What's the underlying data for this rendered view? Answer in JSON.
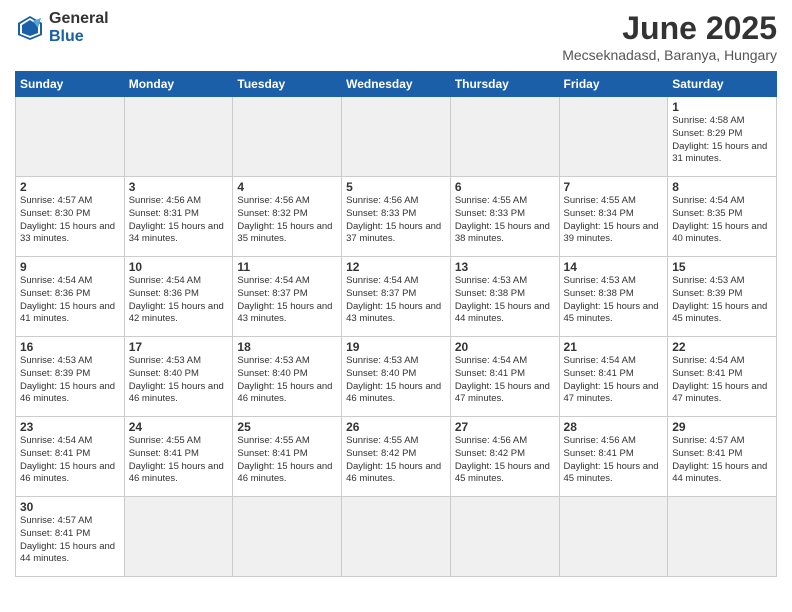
{
  "logo": {
    "general": "General",
    "blue": "Blue"
  },
  "title": "June 2025",
  "subtitle": "Mecseknadasd, Baranya, Hungary",
  "headers": [
    "Sunday",
    "Monday",
    "Tuesday",
    "Wednesday",
    "Thursday",
    "Friday",
    "Saturday"
  ],
  "days": [
    {
      "num": "",
      "sunrise": "",
      "sunset": "",
      "daylight": "",
      "empty": true
    },
    {
      "num": "",
      "sunrise": "",
      "sunset": "",
      "daylight": "",
      "empty": true
    },
    {
      "num": "",
      "sunrise": "",
      "sunset": "",
      "daylight": "",
      "empty": true
    },
    {
      "num": "",
      "sunrise": "",
      "sunset": "",
      "daylight": "",
      "empty": true
    },
    {
      "num": "",
      "sunrise": "",
      "sunset": "",
      "daylight": "",
      "empty": true
    },
    {
      "num": "",
      "sunrise": "",
      "sunset": "",
      "daylight": "",
      "empty": true
    },
    {
      "num": "1",
      "sunrise": "Sunrise: 4:58 AM",
      "sunset": "Sunset: 8:29 PM",
      "daylight": "Daylight: 15 hours and 31 minutes."
    },
    {
      "num": "2",
      "sunrise": "Sunrise: 4:57 AM",
      "sunset": "Sunset: 8:30 PM",
      "daylight": "Daylight: 15 hours and 33 minutes."
    },
    {
      "num": "3",
      "sunrise": "Sunrise: 4:56 AM",
      "sunset": "Sunset: 8:31 PM",
      "daylight": "Daylight: 15 hours and 34 minutes."
    },
    {
      "num": "4",
      "sunrise": "Sunrise: 4:56 AM",
      "sunset": "Sunset: 8:32 PM",
      "daylight": "Daylight: 15 hours and 35 minutes."
    },
    {
      "num": "5",
      "sunrise": "Sunrise: 4:56 AM",
      "sunset": "Sunset: 8:33 PM",
      "daylight": "Daylight: 15 hours and 37 minutes."
    },
    {
      "num": "6",
      "sunrise": "Sunrise: 4:55 AM",
      "sunset": "Sunset: 8:33 PM",
      "daylight": "Daylight: 15 hours and 38 minutes."
    },
    {
      "num": "7",
      "sunrise": "Sunrise: 4:55 AM",
      "sunset": "Sunset: 8:34 PM",
      "daylight": "Daylight: 15 hours and 39 minutes."
    },
    {
      "num": "8",
      "sunrise": "Sunrise: 4:54 AM",
      "sunset": "Sunset: 8:35 PM",
      "daylight": "Daylight: 15 hours and 40 minutes."
    },
    {
      "num": "9",
      "sunrise": "Sunrise: 4:54 AM",
      "sunset": "Sunset: 8:36 PM",
      "daylight": "Daylight: 15 hours and 41 minutes."
    },
    {
      "num": "10",
      "sunrise": "Sunrise: 4:54 AM",
      "sunset": "Sunset: 8:36 PM",
      "daylight": "Daylight: 15 hours and 42 minutes."
    },
    {
      "num": "11",
      "sunrise": "Sunrise: 4:54 AM",
      "sunset": "Sunset: 8:37 PM",
      "daylight": "Daylight: 15 hours and 43 minutes."
    },
    {
      "num": "12",
      "sunrise": "Sunrise: 4:54 AM",
      "sunset": "Sunset: 8:37 PM",
      "daylight": "Daylight: 15 hours and 43 minutes."
    },
    {
      "num": "13",
      "sunrise": "Sunrise: 4:53 AM",
      "sunset": "Sunset: 8:38 PM",
      "daylight": "Daylight: 15 hours and 44 minutes."
    },
    {
      "num": "14",
      "sunrise": "Sunrise: 4:53 AM",
      "sunset": "Sunset: 8:38 PM",
      "daylight": "Daylight: 15 hours and 45 minutes."
    },
    {
      "num": "15",
      "sunrise": "Sunrise: 4:53 AM",
      "sunset": "Sunset: 8:39 PM",
      "daylight": "Daylight: 15 hours and 45 minutes."
    },
    {
      "num": "16",
      "sunrise": "Sunrise: 4:53 AM",
      "sunset": "Sunset: 8:39 PM",
      "daylight": "Daylight: 15 hours and 46 minutes."
    },
    {
      "num": "17",
      "sunrise": "Sunrise: 4:53 AM",
      "sunset": "Sunset: 8:40 PM",
      "daylight": "Daylight: 15 hours and 46 minutes."
    },
    {
      "num": "18",
      "sunrise": "Sunrise: 4:53 AM",
      "sunset": "Sunset: 8:40 PM",
      "daylight": "Daylight: 15 hours and 46 minutes."
    },
    {
      "num": "19",
      "sunrise": "Sunrise: 4:53 AM",
      "sunset": "Sunset: 8:40 PM",
      "daylight": "Daylight: 15 hours and 46 minutes."
    },
    {
      "num": "20",
      "sunrise": "Sunrise: 4:54 AM",
      "sunset": "Sunset: 8:41 PM",
      "daylight": "Daylight: 15 hours and 47 minutes."
    },
    {
      "num": "21",
      "sunrise": "Sunrise: 4:54 AM",
      "sunset": "Sunset: 8:41 PM",
      "daylight": "Daylight: 15 hours and 47 minutes."
    },
    {
      "num": "22",
      "sunrise": "Sunrise: 4:54 AM",
      "sunset": "Sunset: 8:41 PM",
      "daylight": "Daylight: 15 hours and 47 minutes."
    },
    {
      "num": "23",
      "sunrise": "Sunrise: 4:54 AM",
      "sunset": "Sunset: 8:41 PM",
      "daylight": "Daylight: 15 hours and 46 minutes."
    },
    {
      "num": "24",
      "sunrise": "Sunrise: 4:55 AM",
      "sunset": "Sunset: 8:41 PM",
      "daylight": "Daylight: 15 hours and 46 minutes."
    },
    {
      "num": "25",
      "sunrise": "Sunrise: 4:55 AM",
      "sunset": "Sunset: 8:41 PM",
      "daylight": "Daylight: 15 hours and 46 minutes."
    },
    {
      "num": "26",
      "sunrise": "Sunrise: 4:55 AM",
      "sunset": "Sunset: 8:42 PM",
      "daylight": "Daylight: 15 hours and 46 minutes."
    },
    {
      "num": "27",
      "sunrise": "Sunrise: 4:56 AM",
      "sunset": "Sunset: 8:42 PM",
      "daylight": "Daylight: 15 hours and 45 minutes."
    },
    {
      "num": "28",
      "sunrise": "Sunrise: 4:56 AM",
      "sunset": "Sunset: 8:41 PM",
      "daylight": "Daylight: 15 hours and 45 minutes."
    },
    {
      "num": "29",
      "sunrise": "Sunrise: 4:57 AM",
      "sunset": "Sunset: 8:41 PM",
      "daylight": "Daylight: 15 hours and 44 minutes."
    },
    {
      "num": "30",
      "sunrise": "Sunrise: 4:57 AM",
      "sunset": "Sunset: 8:41 PM",
      "daylight": "Daylight: 15 hours and 44 minutes."
    },
    {
      "num": "",
      "sunrise": "",
      "sunset": "",
      "daylight": "",
      "empty": true
    },
    {
      "num": "",
      "sunrise": "",
      "sunset": "",
      "daylight": "",
      "empty": true
    },
    {
      "num": "",
      "sunrise": "",
      "sunset": "",
      "daylight": "",
      "empty": true
    },
    {
      "num": "",
      "sunrise": "",
      "sunset": "",
      "daylight": "",
      "empty": true
    },
    {
      "num": "",
      "sunrise": "",
      "sunset": "",
      "daylight": "",
      "empty": true
    }
  ]
}
